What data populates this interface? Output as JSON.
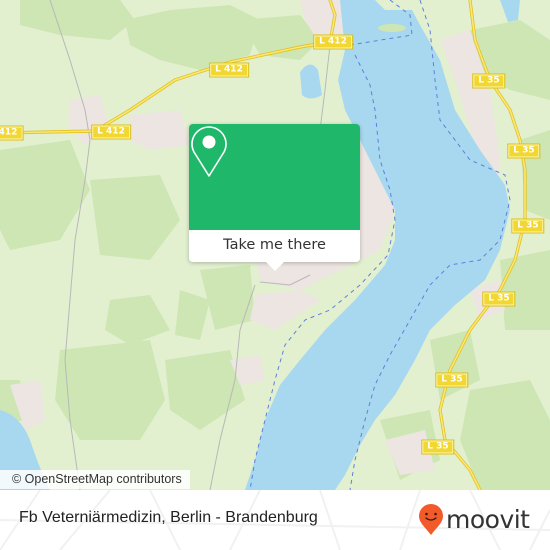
{
  "map": {
    "attribution": "© OpenStreetMap contributors",
    "road_labels": [
      {
        "text": "L 412",
        "road": "L 412"
      },
      {
        "text": "L 412",
        "road": "L 412"
      },
      {
        "text": "412",
        "road": "L 412"
      },
      {
        "text": "L 412",
        "road": "L 412"
      },
      {
        "text": "L 35",
        "road": "L 35"
      },
      {
        "text": "L 35",
        "road": "L 35"
      },
      {
        "text": "L 35",
        "road": "L 35"
      },
      {
        "text": "L 35",
        "road": "L 35"
      },
      {
        "text": "L 35",
        "road": "L 35"
      },
      {
        "text": "L 35",
        "road": "L 35"
      }
    ],
    "colors": {
      "water": "#a8d8ef",
      "forest": "#cde6b4",
      "meadow": "#e2f0d0",
      "urban": "#ede6e2",
      "road": "#f4d94a",
      "boundary": "#5f7fd9"
    }
  },
  "popup": {
    "icon": "location-pin-icon",
    "button_label": "Take me there",
    "color": "#1fb86a"
  },
  "footer": {
    "place_title": "Fb Veterniärmedizin, Berlin - Brandenburg",
    "brand": "moovit",
    "brand_color": "#f25a29"
  }
}
